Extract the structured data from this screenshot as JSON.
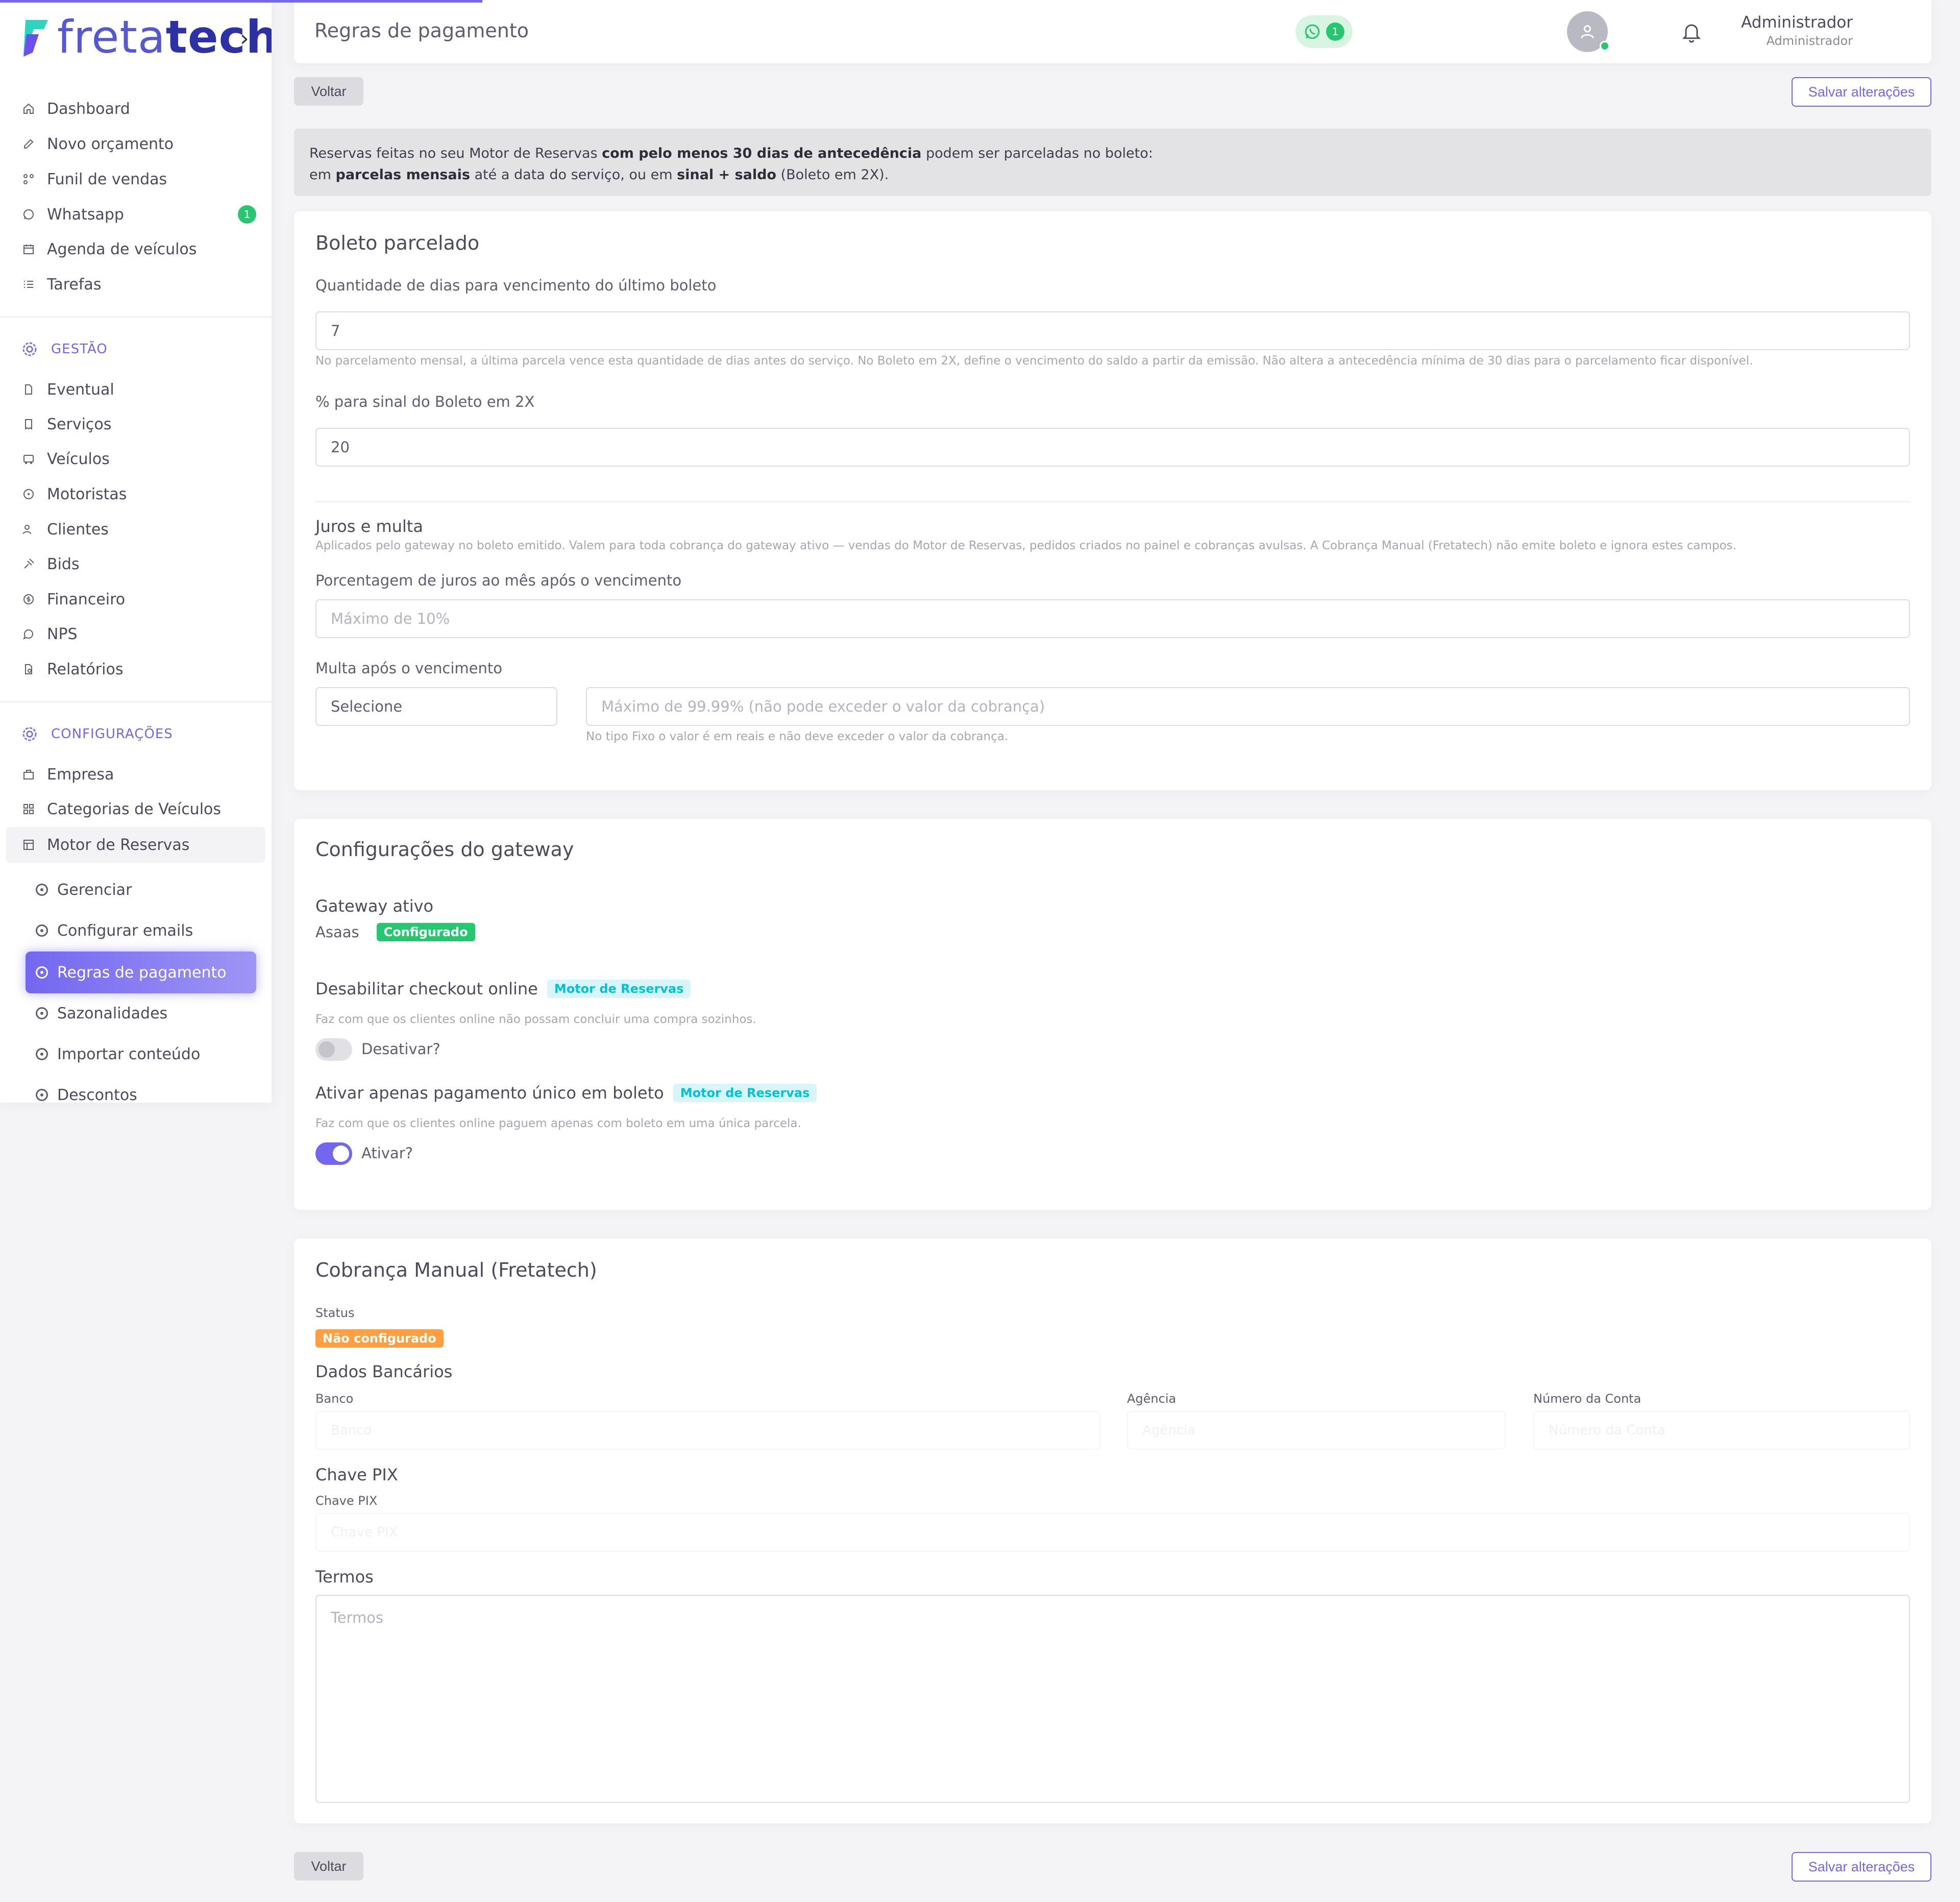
{
  "brand": {
    "logo_light": "freta",
    "logo_bold": "tech",
    "accent": "#7367f0"
  },
  "sidebar": {
    "main_items": [
      {
        "label": "Dashboard",
        "icon": "home-icon"
      },
      {
        "label": "Novo orçamento",
        "icon": "edit-icon"
      },
      {
        "label": "Funil de vendas",
        "icon": "funnel-icon"
      },
      {
        "label": "Whatsapp",
        "icon": "whatsapp-icon",
        "badge": "1"
      },
      {
        "label": "Agenda de veículos",
        "icon": "calendar-icon"
      },
      {
        "label": "Tarefas",
        "icon": "list-icon"
      }
    ],
    "gestao_title": "GESTÃO",
    "gestao_items": [
      {
        "label": "Eventual"
      },
      {
        "label": "Serviços"
      },
      {
        "label": "Veículos"
      },
      {
        "label": "Motoristas"
      },
      {
        "label": "Clientes"
      },
      {
        "label": "Bids"
      },
      {
        "label": "Financeiro"
      },
      {
        "label": "NPS"
      },
      {
        "label": "Relatórios"
      }
    ],
    "config_title": "CONFIGURAÇÕES",
    "config_items": [
      {
        "label": "Empresa"
      },
      {
        "label": "Categorias de Veículos"
      },
      {
        "label": "Motor de Reservas"
      }
    ],
    "sub_items": [
      {
        "label": "Gerenciar"
      },
      {
        "label": "Configurar emails"
      },
      {
        "label": "Regras de pagamento"
      },
      {
        "label": "Sazonalidades"
      },
      {
        "label": "Importar conteúdo"
      },
      {
        "label": "Descontos"
      }
    ]
  },
  "header": {
    "title": "Regras de pagamento",
    "whatsapp_count": "1",
    "user_name": "Administrador",
    "user_role": "Administrador"
  },
  "actions": {
    "back_label": "Voltar",
    "save_label": "Salvar alterações"
  },
  "alert": {
    "p1": "Reservas feitas no seu Motor de Reservas ",
    "b1": "com pelo menos 30 dias de antecedência",
    "p2": " podem ser parceladas no boleto:",
    "p3": "em ",
    "b2": "parcelas mensais",
    "p4": " até a data do serviço, ou em ",
    "b3": "sinal + saldo",
    "p5": " (Boleto em 2X)."
  },
  "boleto": {
    "title": "Boleto parcelado",
    "days_label": "Quantidade de dias para vencimento do último boleto",
    "days_value": "7",
    "days_help": "No parcelamento mensal, a última parcela vence esta quantidade de dias antes do serviço. No Boleto em 2X, define o vencimento do saldo a partir da emissão. Não altera a antecedência mínima de 30 dias para o parcelamento ficar disponível.",
    "signal_label": "% para sinal do Boleto em 2X",
    "signal_value": "20",
    "interest_title": "Juros e multa",
    "interest_help": "Aplicados pelo gateway no boleto emitido. Valem para toda cobrança do gateway ativo — vendas do Motor de Reservas, pedidos criados no painel e cobranças avulsas. A Cobrança Manual (Fretatech) não emite boleto e ignora estes campos.",
    "interest_label": "Porcentagem de juros ao mês após o vencimento",
    "interest_placeholder": "Máximo de 10%",
    "fine_label": "Multa após o vencimento",
    "fine_select": "Selecione",
    "fine_placeholder": "Máximo de 99.99% (não pode exceder o valor da cobrança)",
    "fine_help": "No tipo Fixo o valor é em reais e não deve exceder o valor da cobrança."
  },
  "gateway": {
    "title": "Configurações do gateway",
    "active_label": "Gateway ativo",
    "active_value": "Asaas",
    "active_badge": "Configurado",
    "checkout_title": "Desabilitar checkout online",
    "checkout_badge": "Motor de Reservas",
    "checkout_help": "Faz com que os clientes online não possam concluir uma compra sozinhos.",
    "checkout_toggle": "Desativar?",
    "single_title": "Ativar apenas pagamento único em boleto",
    "single_badge": "Motor de Reservas",
    "single_help": "Faz com que os clientes online paguem apenas com boleto em uma única parcela.",
    "single_toggle": "Ativar?"
  },
  "manual": {
    "title": "Cobrança Manual (Fretatech)",
    "status_label": "Status",
    "status_badge": "Não configurado",
    "bank_section": "Dados Bancários",
    "bank_label": "Banco",
    "bank_placeholder": "Banco",
    "agency_label": "Agência",
    "agency_placeholder": "Agência",
    "account_label": "Número da Conta",
    "account_placeholder": "Número da Conta",
    "pix_section": "Chave PIX",
    "pix_label": "Chave PIX",
    "pix_placeholder": "Chave PIX",
    "terms_section": "Termos",
    "terms_placeholder": "Termos"
  }
}
